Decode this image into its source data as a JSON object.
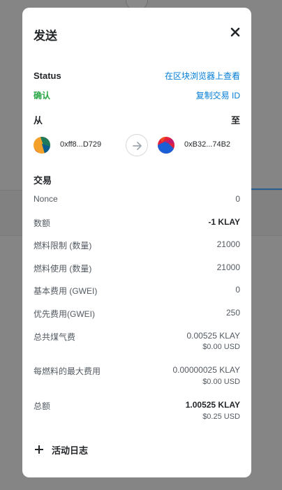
{
  "modal": {
    "title": "发送",
    "status_label": "Status",
    "explorer_link": "在区块浏览器上查看",
    "status_value": "确认",
    "copy_tx_id": "复制交易 ID",
    "from_label": "从",
    "to_label": "至",
    "from_address": "0xff8...D729",
    "to_address": "0xB32...74B2",
    "transaction_label": "交易",
    "rows": {
      "nonce": {
        "label": "Nonce",
        "value": "0"
      },
      "amount": {
        "label": "数额",
        "value": "-1 KLAY"
      },
      "gas_limit": {
        "label": "燃料限制 (数量)",
        "value": "21000"
      },
      "gas_used": {
        "label": "燃料使用 (数量)",
        "value": "21000"
      },
      "base_fee": {
        "label": "基本费用 (GWEI)",
        "value": "0"
      },
      "priority_fee": {
        "label": "优先费用(GWEI)",
        "value": "250"
      },
      "total_gas_fee": {
        "label": "总共煤气费",
        "value": "0.00525 KLAY",
        "fiat": "$0.00 USD"
      },
      "max_fee_per_gas": {
        "label": "每燃料的最大费用",
        "value": "0.00000025 KLAY",
        "fiat": "$0.00 USD"
      },
      "total": {
        "label": "总额",
        "value": "1.00525 KLAY",
        "fiat": "$0.25 USD"
      }
    },
    "activity_log_label": "活动日志"
  },
  "colors": {
    "link": "#037dd6",
    "success": "#28a745",
    "overlay": "#858585"
  },
  "icons": [
    "close-icon",
    "arrow-right-icon",
    "plus-icon"
  ]
}
